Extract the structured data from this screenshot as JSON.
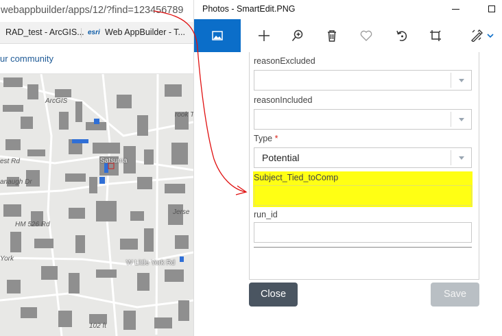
{
  "browser": {
    "url": "webappbuilder/apps/12/?find=123456789",
    "bookmarks": [
      "RAD_test - ArcGIS...",
      "Web AppBuilder - T..."
    ],
    "esri_logo": "esri",
    "community_text": "ur community",
    "map_labels": {
      "arcgis": "ArcGIS",
      "brook": "rook Tr",
      "satsuma": "Satsuma",
      "west_rd": "est Rd",
      "anaugh": "anaugh Dr",
      "hm": "HM 526 Rd",
      "jerse": "Jerse",
      "wlittle": "W Little York Rd",
      "york": "York",
      "elev": "102 ft"
    }
  },
  "photos": {
    "title": "Photos - SmartEdit.PNG",
    "toolbar_icons": [
      "photo-icon",
      "add-icon",
      "zoom-in-icon",
      "delete-icon",
      "favorite-icon",
      "rotate-icon",
      "crop-icon",
      "edit-icon"
    ],
    "form": {
      "fields": [
        {
          "label": "reasonExcluded",
          "value": ""
        },
        {
          "label": "reasonIncluded",
          "value": ""
        },
        {
          "label": "Type",
          "required_mark": "*",
          "value": "Potential"
        },
        {
          "label": "Subject_Tied_toComp",
          "value": ""
        },
        {
          "label": "run_id",
          "value": ""
        }
      ]
    },
    "buttons": {
      "close": "Close",
      "save": "Save"
    }
  },
  "colors": {
    "accent": "#0b6ec9",
    "highlight": "#ffff14",
    "annotation": "#e01010",
    "close_button": "#4a5561",
    "save_button_disabled": "#b9bfc4"
  }
}
